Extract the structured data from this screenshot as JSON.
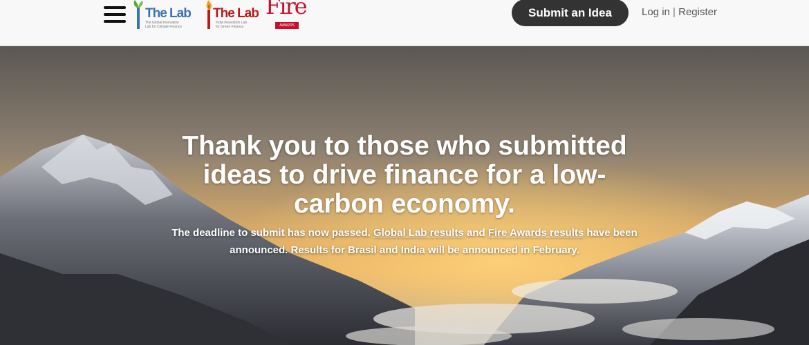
{
  "header": {
    "logos": [
      {
        "title": "The Lab",
        "subtitle_line1": "The Global Innovation",
        "subtitle_line2": "Lab for Climate Finance"
      },
      {
        "title": "The Lab",
        "subtitle_line1": "India Innovation Lab",
        "subtitle_line2": "for Green Finance"
      },
      {
        "title": "Fire",
        "badge": "AWARDS"
      }
    ],
    "submit_label": "Submit an Idea",
    "login_label": "Log in",
    "separator": "|",
    "register_label": "Register"
  },
  "hero": {
    "headline": "Thank you to those who submitted ideas to drive finance for a low-carbon economy.",
    "text_before": "The deadline to submit has now passed. ",
    "link_global": "Global Lab results",
    "text_and": " and ",
    "link_fire": "Fire Awards results",
    "text_after": " have been announced. Results for Brasil and India will be announced in February."
  },
  "colors": {
    "header_bg": "#f8f8f8",
    "button_bg": "#333333",
    "global_lab_blue": "#3a74b2",
    "india_lab_red": "#b71c1c",
    "fire_red": "#c8102e"
  },
  "icons": [
    "menu-icon",
    "plant-icon",
    "flame-icon"
  ]
}
